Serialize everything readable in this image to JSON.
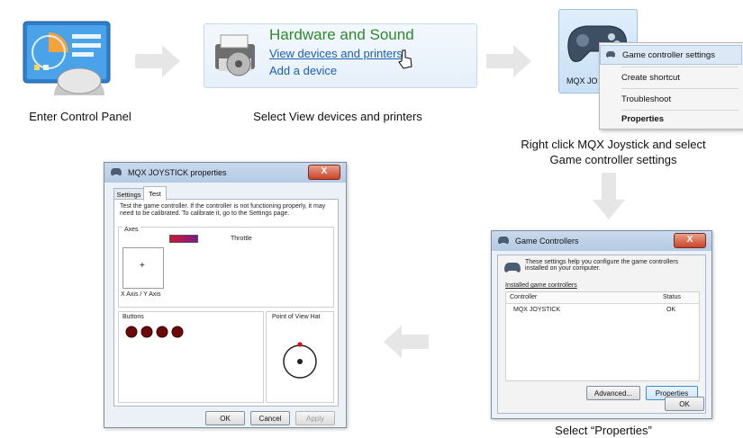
{
  "step1": {
    "caption": "Enter Control Panel"
  },
  "step2": {
    "title": "Hardware and Sound",
    "link": "View devices and printers",
    "add": "Add a device",
    "caption": "Select View devices and printers"
  },
  "step3": {
    "device_label": "MQX JO",
    "menu": [
      "Game controller settings",
      "Create shortcut",
      "Troubleshoot",
      "Properties"
    ],
    "caption_line1": "Right click MQX Joystick and select",
    "caption_line2": "Game controller settings"
  },
  "step4": {
    "window_title": "Game Controllers",
    "close": "X",
    "info": "These settings help you configure the game controllers installed on your computer.",
    "group_label": "Installed game controllers",
    "col_controller": "Controller",
    "col_status": "Status",
    "row_controller": "MQX JOYSTICK",
    "row_status": "OK",
    "btn_advanced": "Advanced...",
    "btn_properties": "Properties",
    "btn_ok": "OK",
    "caption": "Select “Properties”"
  },
  "step5": {
    "window_title": "MQX JOYSTICK  properties",
    "close": "X",
    "tab_settings": "Settings",
    "tab_test": "Test",
    "desc": "Test the game controller.  If the controller is not functioning properly, it may need to be calibrated.  To calibrate it, go to the Settings page.",
    "axes_label": "Axes",
    "throttle_label": "Throttle",
    "xy_label": "X Axis / Y Axis",
    "buttons_label": "Buttons",
    "pov_label": "Point of View Hat",
    "btn_ok": "OK",
    "btn_cancel": "Cancel",
    "btn_apply": "Apply"
  },
  "colors": {
    "green_title": "#2c8a2c",
    "link_blue": "#1a5fb4",
    "button_dot": "#6b0a0a",
    "throttle_bar": "#a0186a"
  }
}
